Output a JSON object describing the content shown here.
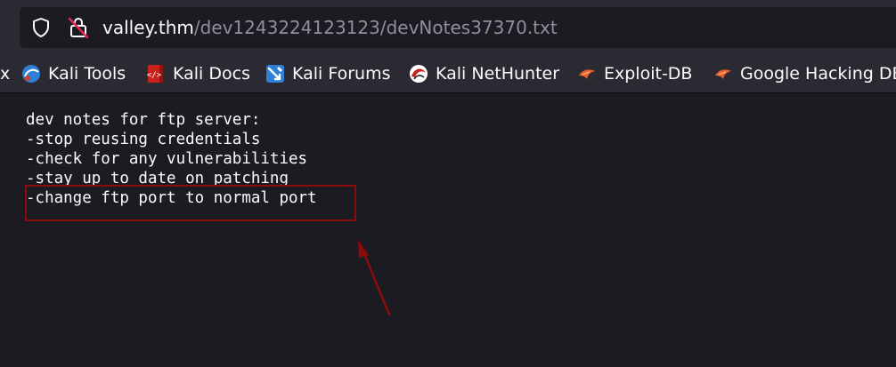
{
  "urlbar": {
    "host": "valley.thm",
    "path": "/dev1243224123123/devNotes37370.txt",
    "shield_icon": "shield-icon",
    "lock_icon": "insecure-lock-icon"
  },
  "bookmarks": {
    "cut_left": "x",
    "items": [
      {
        "label": "Kali Tools",
        "icon": "kali-tools-icon"
      },
      {
        "label": "Kali Docs",
        "icon": "kali-docs-icon"
      },
      {
        "label": "Kali Forums",
        "icon": "kali-forums-icon"
      },
      {
        "label": "Kali NetHunter",
        "icon": "kali-nethunter-icon"
      },
      {
        "label": "Exploit-DB",
        "icon": "exploit-db-icon"
      },
      {
        "label": "Google Hacking DB",
        "icon": "exploit-db-icon"
      }
    ]
  },
  "document": {
    "lines": [
      "dev notes for ftp server:",
      "-stop reusing credentials",
      "-check for any vulnerabilities",
      "-stay up to date on patching",
      "-change ftp port to normal port"
    ]
  },
  "colors": {
    "highlight": "#8b0c0c",
    "background": "#1c1b22",
    "toolbar": "#2b2a33"
  }
}
